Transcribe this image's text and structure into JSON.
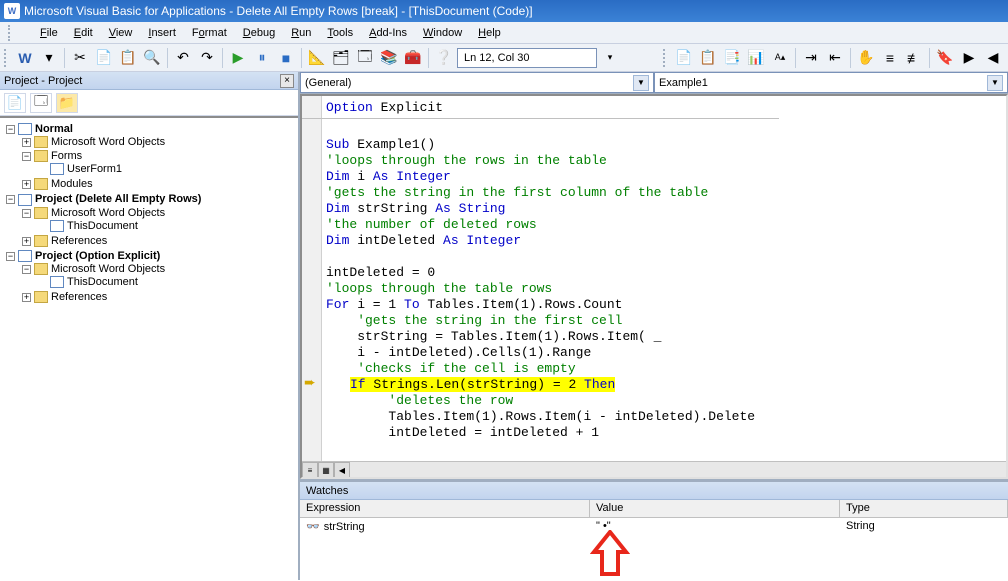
{
  "title": "Microsoft Visual Basic for Applications - Delete All Empty Rows [break] - [ThisDocument (Code)]",
  "menu": {
    "file": "File",
    "edit": "Edit",
    "view": "View",
    "insert": "Insert",
    "format": "Format",
    "debug": "Debug",
    "run": "Run",
    "tools": "Tools",
    "addins": "Add-Ins",
    "window": "Window",
    "help": "Help"
  },
  "position": "Ln 12, Col 30",
  "project": {
    "title": "Project - Project",
    "tree": {
      "normal": "Normal",
      "mwo1": "Microsoft Word Objects",
      "forms": "Forms",
      "userform1": "UserForm1",
      "modules": "Modules",
      "proj2": "Project (Delete All Empty Rows)",
      "mwo2": "Microsoft Word Objects",
      "thisdoc2": "ThisDocument",
      "ref2": "References",
      "proj3": "Project (Option Explicit)",
      "mwo3": "Microsoft Word Objects",
      "thisdoc3": "ThisDocument",
      "ref3": "References"
    }
  },
  "dropdowns": {
    "left": "(General)",
    "right": "Example1"
  },
  "code": {
    "l1a": "Option",
    "l1b": " Explicit",
    "l3a": "Sub",
    "l3b": " Example1()",
    "l4": "'loops through the rows in the table",
    "l5a": "Dim",
    "l5b": " i ",
    "l5c": "As Integer",
    "l6": "'gets the string in the first column of the table",
    "l7a": "Dim",
    "l7b": " strString ",
    "l7c": "As String",
    "l8": "'the number of deleted rows",
    "l9a": "Dim",
    "l9b": " intDeleted ",
    "l9c": "As Integer",
    "l11": "intDeleted = 0",
    "l12": "'loops through the table rows",
    "l13a": "For",
    "l13b": " i = 1 ",
    "l13c": "To",
    "l13d": " Tables.Item(1).Rows.Count",
    "l14": "    'gets the string in the first cell",
    "l15": "    strString = Tables.Item(1).Rows.Item( _",
    "l16": "    i - intDeleted).Cells(1).Range",
    "l17": "    'checks if the cell is empty",
    "l18a": "If",
    "l18b": " Strings.Len(strString) = 2 ",
    "l18c": "Then",
    "l19": "        'deletes the row",
    "l20": "        Tables.Item(1).Rows.Item(i - intDeleted).Delete",
    "l21": "        intDeleted = intDeleted + 1"
  },
  "watches": {
    "title": "Watches",
    "col1": "Expression",
    "col2": "Value",
    "col3": "Type",
    "row": {
      "expr": "strString",
      "val": "\" •\"",
      "type": "String"
    }
  }
}
